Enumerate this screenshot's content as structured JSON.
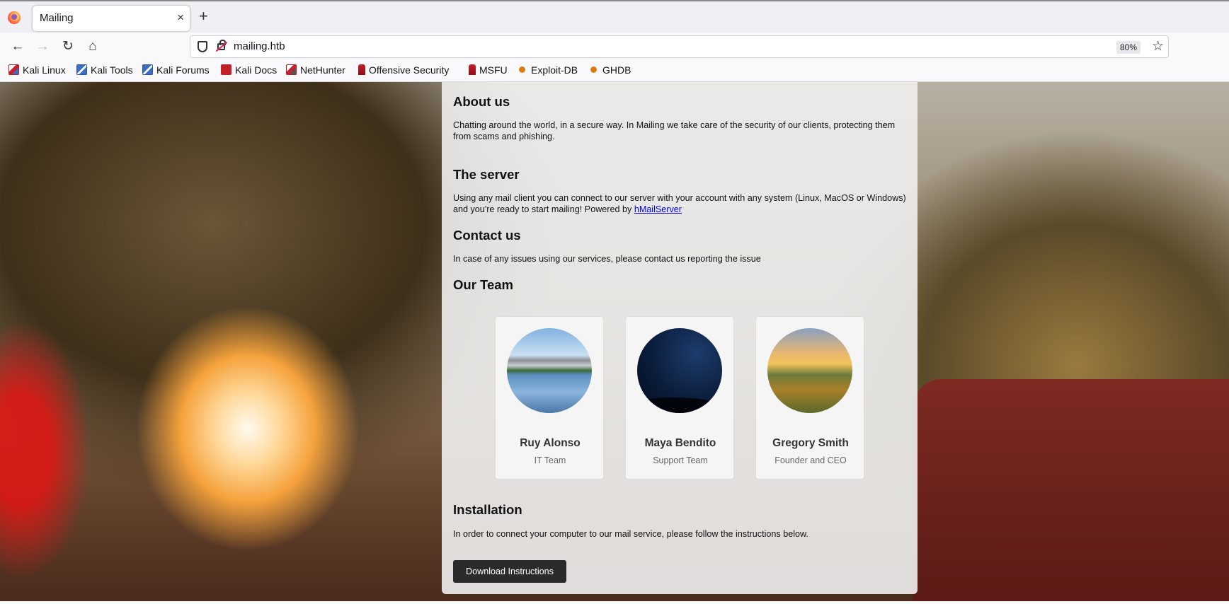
{
  "browser": {
    "tab_title": "Mailing",
    "tab_close": "×",
    "new_tab": "+",
    "url": "mailing.htb",
    "zoom": "80%",
    "icons": [
      "firefox-icon",
      "back-icon",
      "forward-icon",
      "reload-icon",
      "home-icon",
      "shield-icon",
      "insecure-lock-icon",
      "star-icon"
    ]
  },
  "bookmarks": [
    {
      "label": "Kali Linux"
    },
    {
      "label": "Kali Tools"
    },
    {
      "label": "Kali Forums"
    },
    {
      "label": "Kali Docs"
    },
    {
      "label": "NetHunter"
    },
    {
      "label": "Offensive Security"
    },
    {
      "label": "MSFU"
    },
    {
      "label": "Exploit-DB"
    },
    {
      "label": "GHDB"
    }
  ],
  "page": {
    "about": {
      "heading": "About us",
      "text": "Chatting around the world, in a secure way. In Mailing we take care of the security of our clients, protecting them from scams and phishing."
    },
    "server": {
      "heading": "The server",
      "text": "Using any mail client you can connect to our server with your account with any system (Linux, MacOS or Windows) and you're ready to start mailing! Powered by ",
      "link": "hMailServer"
    },
    "contact": {
      "heading": "Contact us",
      "text": "In case of any issues using our services, please contact us reporting the issue"
    },
    "team": {
      "heading": "Our Team",
      "members": [
        {
          "name": "Ruy Alonso",
          "role": "IT Team"
        },
        {
          "name": "Maya Bendito",
          "role": "Support Team"
        },
        {
          "name": "Gregory Smith",
          "role": "Founder and CEO"
        }
      ]
    },
    "installation": {
      "heading": "Installation",
      "text": "In order to connect your computer to our mail service, please follow the instructions below.",
      "button": "Download Instructions"
    }
  }
}
